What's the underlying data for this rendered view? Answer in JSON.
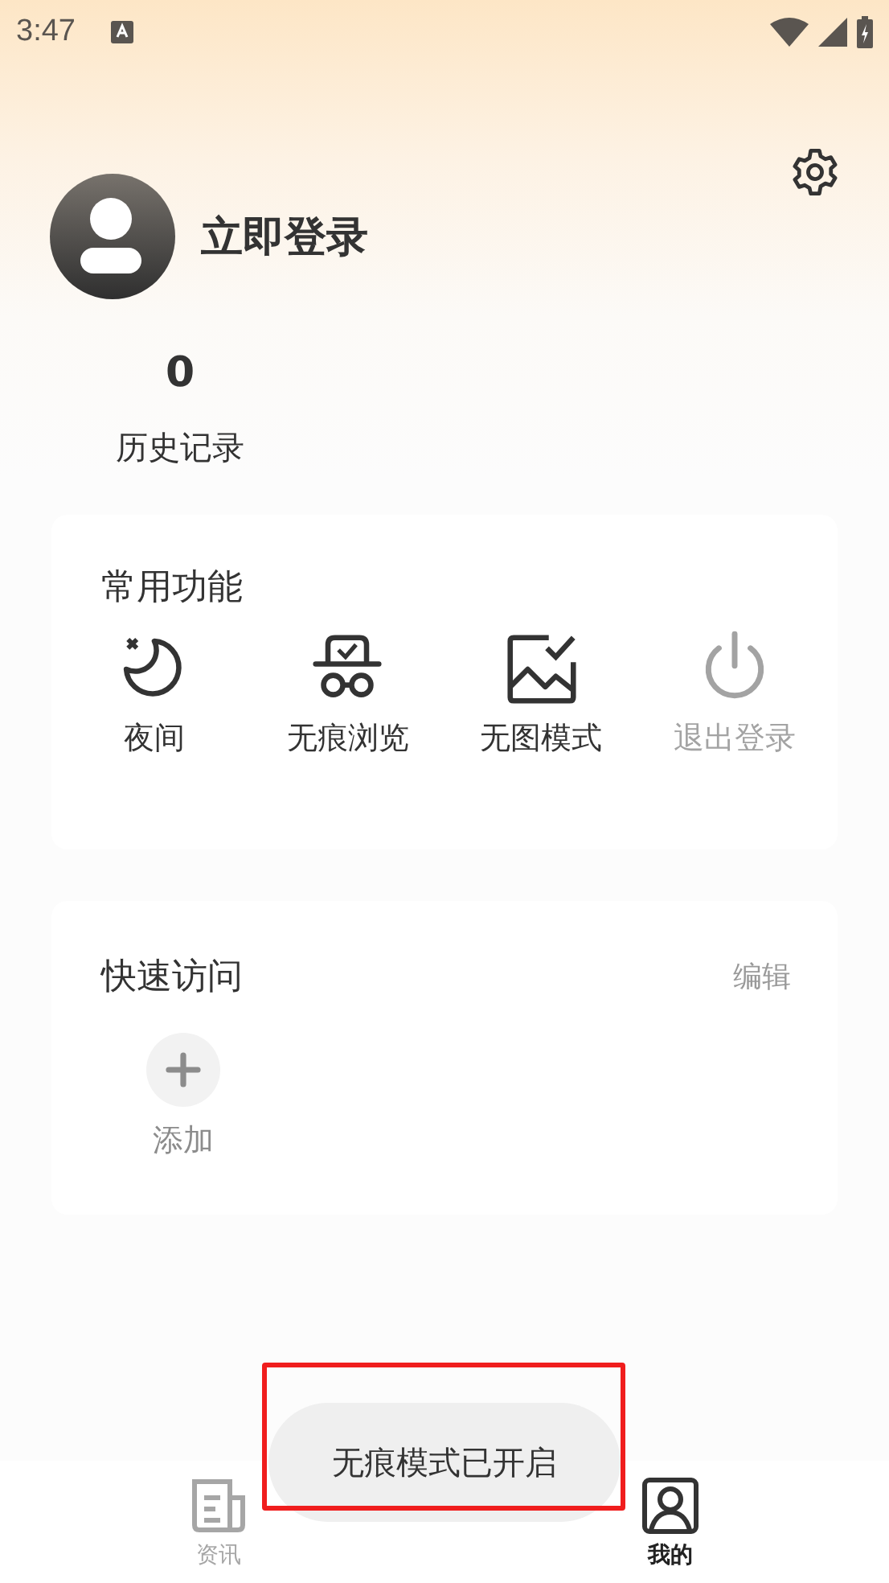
{
  "status_bar": {
    "time": "3:47"
  },
  "profile": {
    "login_label": "立即登录"
  },
  "stats": [
    {
      "value": "0",
      "label": "历史记录"
    }
  ],
  "common_functions": {
    "title": "常用功能",
    "items": [
      {
        "kind": "moon",
        "label": "夜间",
        "disabled": false
      },
      {
        "kind": "incognito",
        "label": "无痕浏览",
        "disabled": false
      },
      {
        "kind": "noimage",
        "label": "无图模式",
        "disabled": false
      },
      {
        "kind": "power",
        "label": "退出登录",
        "disabled": true
      }
    ]
  },
  "quick_access": {
    "title": "快速访问",
    "edit_label": "编辑",
    "items": [
      {
        "kind": "add",
        "label": "添加"
      }
    ]
  },
  "toast": {
    "message": "无痕模式已开启"
  },
  "tabs": [
    {
      "kind": "news",
      "label": "资讯",
      "selected": false
    },
    {
      "kind": "profile",
      "label": "我的",
      "selected": true
    }
  ]
}
